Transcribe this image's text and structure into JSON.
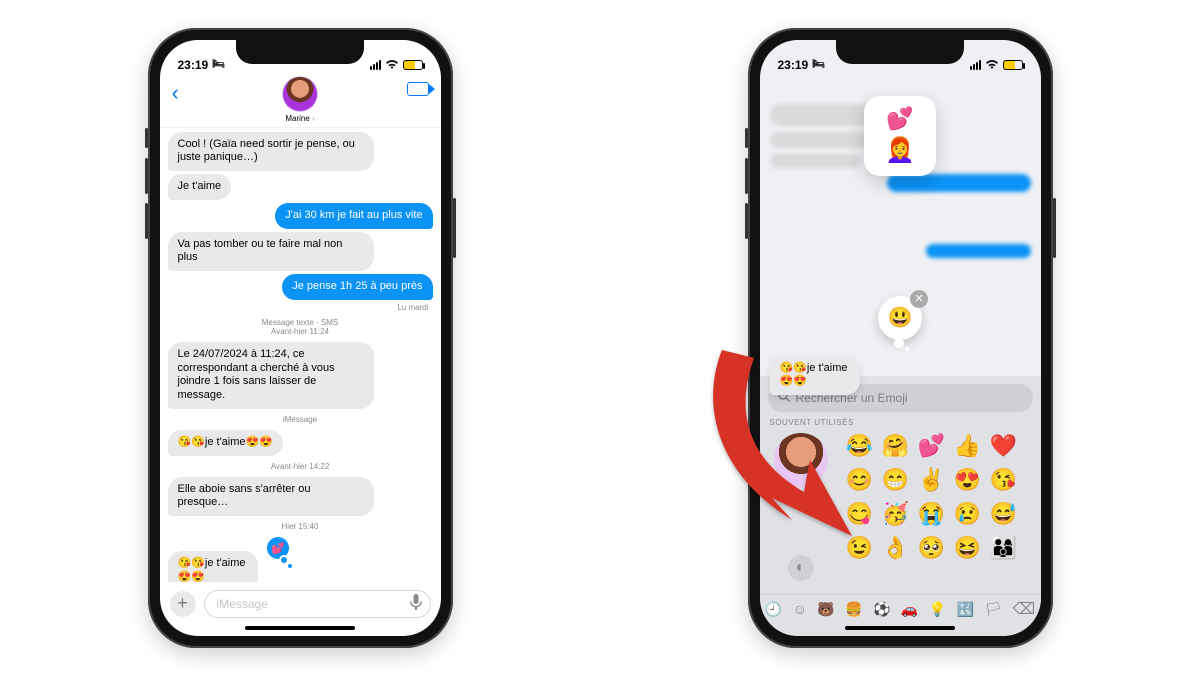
{
  "status": {
    "time": "23:19",
    "dnd": "🛏"
  },
  "left": {
    "contact_name": "Marine",
    "messages": {
      "m1": "Cool ! (Gaïa need sortir je pense, ou juste panique…)",
      "m2": "Je t'aime",
      "m3": "J'ai 30 km je fait au plus vite",
      "m4": "Va pas tomber ou te faire mal non plus",
      "m5": "Je pense 1h 25 à peu près",
      "receipt": "Lu mardi",
      "meta_sms": "Message texte · SMS",
      "meta_sms_time": "Avant-hier 11:24",
      "m6": "Le 24/07/2024 à 11:24, ce correspondant a cherché à vous joindre 1 fois sans laisser de message.",
      "meta_imsg": "iMessage",
      "m7": "😘😘je t'aime😍😍",
      "meta_t2": "Avant-hier 14:22",
      "m8": "Elle aboie sans s'arrêter ou presque…",
      "meta_t3": "Hier 15:40",
      "m9": "😘😘je t'aime😍😍"
    },
    "compose": {
      "placeholder": "iMessage"
    }
  },
  "right": {
    "sticker_popup": {
      "hearts": "💕",
      "memoji": "👩‍🦰"
    },
    "tapback_picker_face": "😃",
    "focused_message": "😘😘je t'aime😍😍",
    "emoji_kb": {
      "search_placeholder": "Rechercher un Emoji",
      "section_title": "SOUVENT UTILISÉS",
      "grid": [
        "😂",
        "🤗",
        "💕",
        "👍",
        "❤️",
        "😊",
        "😁",
        "✌️",
        "😍",
        "😘",
        "😋",
        "🥳",
        "😭",
        "😢",
        "😅",
        "😉",
        "👌",
        "🥺",
        "😆",
        "👨‍👩‍👦"
      ],
      "sticker_icon": "◐",
      "tabs": {
        "recent": "🕘",
        "smiley": "☺",
        "animals": "🐻",
        "food": "🍔",
        "activity": "⚽",
        "travel": "🚗",
        "objects": "💡",
        "symbols": "🔣",
        "flags": "🏳",
        "delete": "⌫"
      }
    }
  }
}
